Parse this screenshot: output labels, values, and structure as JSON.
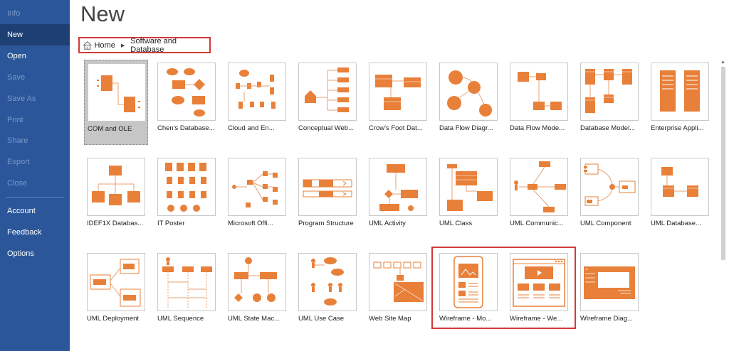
{
  "sidebar": {
    "items": [
      {
        "label": "Info",
        "state": "disabled"
      },
      {
        "label": "New",
        "state": "active"
      },
      {
        "label": "Open",
        "state": "normal"
      },
      {
        "label": "Save",
        "state": "disabled"
      },
      {
        "label": "Save As",
        "state": "disabled"
      },
      {
        "label": "Print",
        "state": "disabled"
      },
      {
        "label": "Share",
        "state": "disabled"
      },
      {
        "label": "Export",
        "state": "disabled"
      },
      {
        "label": "Close",
        "state": "disabled"
      },
      {
        "label": "Account",
        "state": "normal"
      },
      {
        "label": "Feedback",
        "state": "normal"
      },
      {
        "label": "Options",
        "state": "normal"
      }
    ]
  },
  "main": {
    "title": "New",
    "breadcrumb": {
      "home": "Home",
      "current": "Software and Database"
    },
    "templates": [
      {
        "label": "COM and OLE",
        "icon": "com-ole-diagram-icon",
        "selected": true
      },
      {
        "label": "Chen's Database...",
        "icon": "chen-database-icon"
      },
      {
        "label": "Cloud and En...",
        "icon": "cloud-enterprise-icon"
      },
      {
        "label": "Conceptual Web...",
        "icon": "conceptual-website-icon"
      },
      {
        "label": "Crow's Foot Dat...",
        "icon": "crows-foot-icon"
      },
      {
        "label": "Data Flow Diagr...",
        "icon": "data-flow-diagram-icon"
      },
      {
        "label": "Data Flow Mode...",
        "icon": "data-flow-model-icon"
      },
      {
        "label": "Database Model...",
        "icon": "database-model-icon"
      },
      {
        "label": "Enterprise Appli...",
        "icon": "enterprise-application-icon"
      },
      {
        "label": "IDEF1X Databas...",
        "icon": "idef1x-icon"
      },
      {
        "label": "IT Poster",
        "icon": "it-poster-icon"
      },
      {
        "label": "Microsoft Offi...",
        "icon": "microsoft-office-icon"
      },
      {
        "label": "Program Structure",
        "icon": "program-structure-icon"
      },
      {
        "label": "UML Activity",
        "icon": "uml-activity-icon"
      },
      {
        "label": "UML Class",
        "icon": "uml-class-icon"
      },
      {
        "label": "UML Communic...",
        "icon": "uml-communication-icon"
      },
      {
        "label": "UML Component",
        "icon": "uml-component-icon"
      },
      {
        "label": "UML Database...",
        "icon": "uml-database-icon"
      },
      {
        "label": "UML Deployment",
        "icon": "uml-deployment-icon"
      },
      {
        "label": "UML Sequence",
        "icon": "uml-sequence-icon"
      },
      {
        "label": "UML State Mac...",
        "icon": "uml-state-machine-icon"
      },
      {
        "label": "UML Use Case",
        "icon": "uml-use-case-icon"
      },
      {
        "label": "Web Site Map",
        "icon": "web-site-map-icon"
      },
      {
        "label": "Wireframe - Mo...",
        "icon": "wireframe-mobile-icon"
      },
      {
        "label": "Wireframe - We...",
        "icon": "wireframe-web-icon"
      },
      {
        "label": "Wireframe Diag...",
        "icon": "wireframe-diagram-icon"
      }
    ]
  },
  "colors": {
    "sidebar": "#2b579a",
    "accent": "#e8803a",
    "highlight": "#d23a3a"
  }
}
